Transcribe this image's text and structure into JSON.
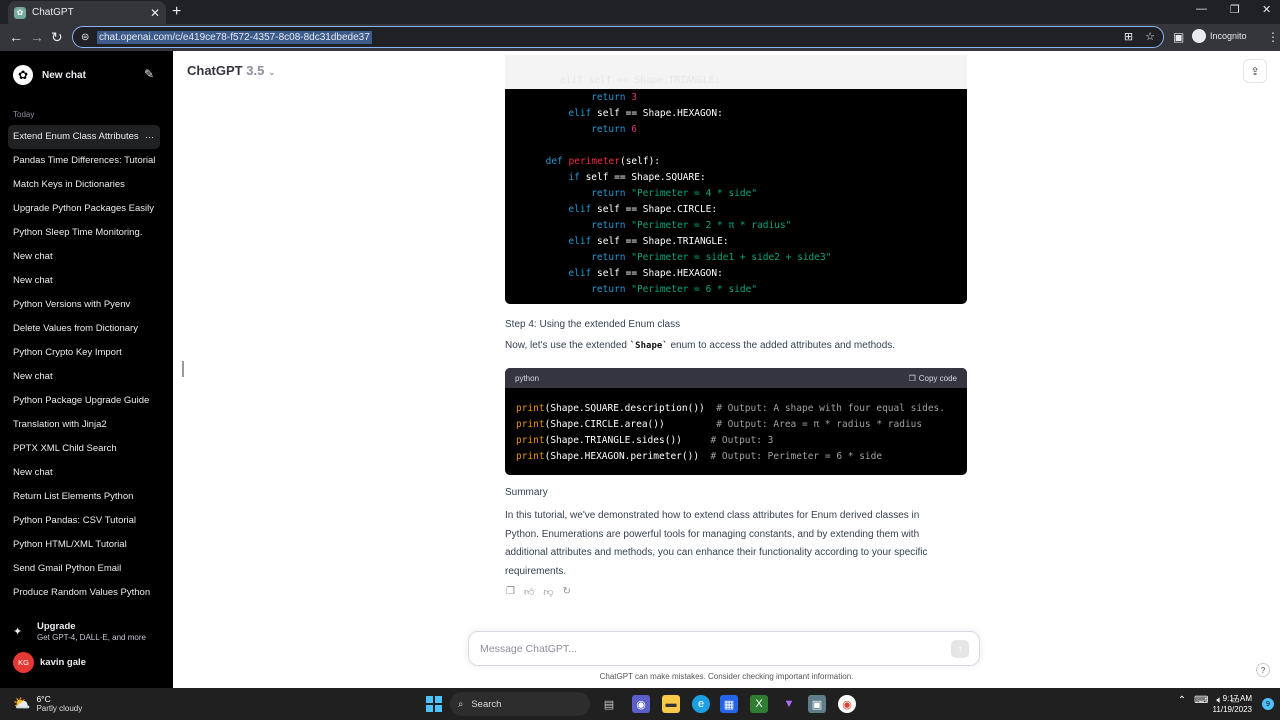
{
  "browser": {
    "tab_title": "ChatGPT",
    "url": "chat.openai.com/c/e419ce78-f572-4357-8c08-8dc31dbede37",
    "incognito_label": "Incognito"
  },
  "sidebar": {
    "new_chat_label": "New chat",
    "section_today": "Today",
    "items": [
      {
        "label": "Extend Enum Class Attributes"
      },
      {
        "label": "Pandas Time Differences: Tutorial"
      },
      {
        "label": "Match Keys in Dictionaries"
      },
      {
        "label": "Upgrade Python Packages Easily"
      },
      {
        "label": "Python Sleep Time Monitoring."
      },
      {
        "label": "New chat"
      },
      {
        "label": "New chat"
      },
      {
        "label": "Python Versions with Pyenv"
      },
      {
        "label": "Delete Values from Dictionary"
      },
      {
        "label": "Python Crypto Key Import"
      },
      {
        "label": "New chat"
      },
      {
        "label": "Python Package Upgrade Guide"
      },
      {
        "label": "Translation with Jinja2"
      },
      {
        "label": "PPTX XML Child Search"
      },
      {
        "label": "New chat"
      },
      {
        "label": "Return List Elements Python"
      },
      {
        "label": "Python Pandas: CSV Tutorial"
      },
      {
        "label": "Python HTML/XML Tutorial"
      },
      {
        "label": "Send Gmail Python Email"
      },
      {
        "label": "Produce Random Values Python"
      }
    ],
    "active_item_more": "···",
    "upgrade_title": "Upgrade",
    "upgrade_sub": "Get GPT-4, DALL·E, and more",
    "user_initials": "KG",
    "user_name": "kavin gale"
  },
  "header": {
    "model_name": "ChatGPT",
    "model_version": "3.5"
  },
  "conversation": {
    "code1": {
      "faded_line": "elif self == Shape.TRIANGLE:",
      "lines": [
        {
          "indent": 7,
          "parts": [
            [
              "kw",
              "return"
            ],
            [
              "",
              ""
            ],
            [
              "num",
              " 3"
            ]
          ]
        },
        {
          "indent": 4,
          "parts": [
            [
              "kw",
              "elif"
            ],
            [
              "",
              " self == Shape.HEXAGON:"
            ]
          ]
        },
        {
          "indent": 7,
          "parts": [
            [
              "kw",
              "return"
            ],
            [
              "num",
              " 6"
            ]
          ]
        },
        {
          "indent": 0,
          "parts": [
            [
              "",
              ""
            ]
          ]
        },
        {
          "indent": 1,
          "parts": [
            [
              "kw",
              "def"
            ],
            [
              "",
              " "
            ],
            [
              "fn",
              "perimeter"
            ],
            [
              "",
              "(self):"
            ]
          ]
        },
        {
          "indent": 4,
          "parts": [
            [
              "kw",
              "if"
            ],
            [
              "",
              " self == Shape.SQUARE:"
            ]
          ]
        },
        {
          "indent": 7,
          "parts": [
            [
              "kw",
              "return"
            ],
            [
              "str",
              " \"Perimeter = 4 * side\""
            ]
          ]
        },
        {
          "indent": 4,
          "parts": [
            [
              "kw",
              "elif"
            ],
            [
              "",
              " self == Shape.CIRCLE:"
            ]
          ]
        },
        {
          "indent": 7,
          "parts": [
            [
              "kw",
              "return"
            ],
            [
              "str",
              " \"Perimeter = 2 * π * radius\""
            ]
          ]
        },
        {
          "indent": 4,
          "parts": [
            [
              "kw",
              "elif"
            ],
            [
              "",
              " self == Shape.TRIANGLE:"
            ]
          ]
        },
        {
          "indent": 7,
          "parts": [
            [
              "kw",
              "return"
            ],
            [
              "str",
              " \"Perimeter = side1 + side2 + side3\""
            ]
          ]
        },
        {
          "indent": 4,
          "parts": [
            [
              "kw",
              "elif"
            ],
            [
              "",
              " self == Shape.HEXAGON:"
            ]
          ]
        },
        {
          "indent": 7,
          "parts": [
            [
              "kw",
              "return"
            ],
            [
              "str",
              " \"Perimeter = 6 * side\""
            ]
          ]
        }
      ]
    },
    "step4_title": "Step 4: Using the extended Enum class",
    "step4_text_before": "Now, let's use the extended ",
    "step4_code": "`Shape`",
    "step4_text_after": " enum to access the added attributes and methods.",
    "code2": {
      "language": "python",
      "copy_label": "Copy code",
      "lines": [
        {
          "parts": [
            [
              "pr",
              "print"
            ],
            [
              "",
              "(Shape.SQUARE.description())  "
            ],
            [
              "cm",
              "# Output: A shape with four equal sides."
            ]
          ]
        },
        {
          "parts": [
            [
              "pr",
              "print"
            ],
            [
              "",
              "(Shape.CIRCLE.area())         "
            ],
            [
              "cm",
              "# Output: Area = π * radius * radius"
            ]
          ]
        },
        {
          "parts": [
            [
              "pr",
              "print"
            ],
            [
              "",
              "(Shape.TRIANGLE.sides())     "
            ],
            [
              "cm",
              "# Output: 3"
            ]
          ]
        },
        {
          "parts": [
            [
              "pr",
              "print"
            ],
            [
              "",
              "(Shape.HEXAGON.perimeter())  "
            ],
            [
              "cm",
              "# Output: Perimeter = 6 * side"
            ]
          ]
        }
      ]
    },
    "summary_title": "Summary",
    "summary_lines": [
      "In this tutorial, we've demonstrated how to extend class attributes for Enum derived classes in",
      "Python. Enumerations are powerful tools for managing constants, and by extending them with",
      "additional attributes and methods, you can enhance their functionality according to your specific",
      "requirements."
    ]
  },
  "composer": {
    "placeholder": "Message ChatGPT...",
    "disclaimer": "ChatGPT can make mistakes. Consider checking important information.",
    "help": "?"
  },
  "taskbar": {
    "temp": "6°C",
    "weather": "Partly cloudy",
    "search_label": "Search",
    "time": "9:17 AM",
    "date": "11/19/2023",
    "notification_count": "9"
  }
}
